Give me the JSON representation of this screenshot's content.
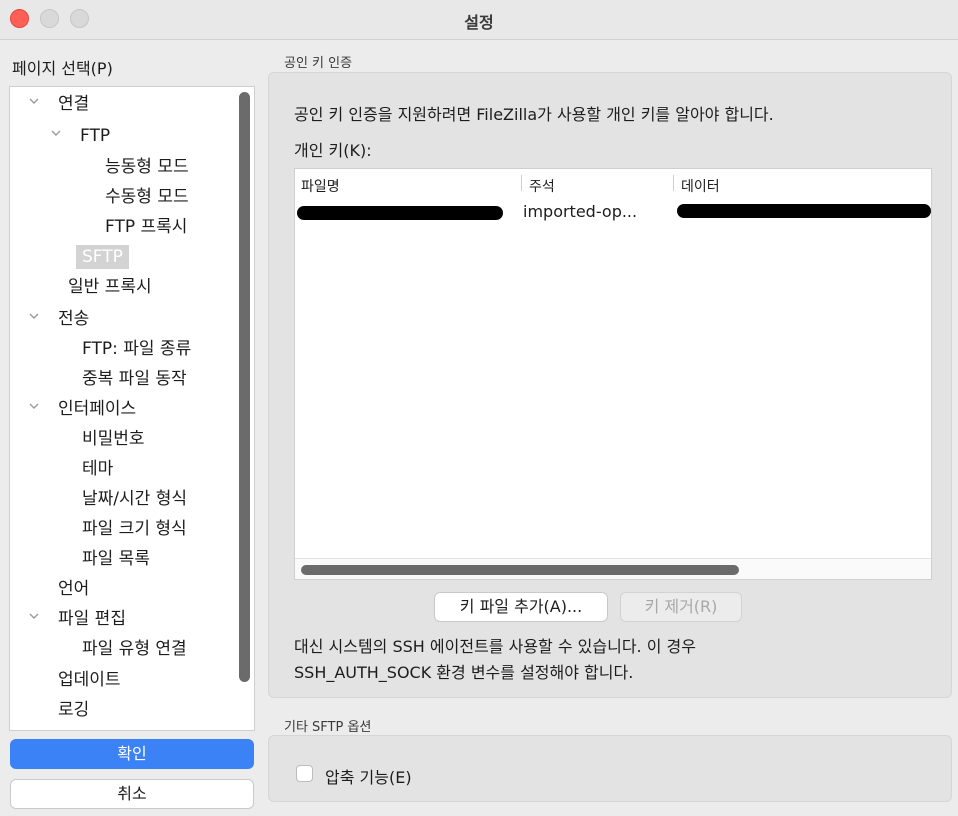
{
  "window": {
    "title": "설정"
  },
  "sidebar": {
    "heading": "페이지 선택(P)",
    "items": [
      {
        "label": "연결"
      },
      {
        "label": "FTP"
      },
      {
        "label": "능동형 모드"
      },
      {
        "label": "수동형 모드"
      },
      {
        "label": "FTP 프록시"
      },
      {
        "label": "SFTP"
      },
      {
        "label": "일반 프록시"
      },
      {
        "label": "전송"
      },
      {
        "label": "FTP: 파일 종류"
      },
      {
        "label": "중복 파일 동작"
      },
      {
        "label": "인터페이스"
      },
      {
        "label": "비밀번호"
      },
      {
        "label": "테마"
      },
      {
        "label": "날짜/시간 형식"
      },
      {
        "label": "파일 크기 형식"
      },
      {
        "label": "파일 목록"
      },
      {
        "label": "언어"
      },
      {
        "label": "파일 편집"
      },
      {
        "label": "파일 유형 연결"
      },
      {
        "label": "업데이트"
      },
      {
        "label": "로깅"
      }
    ],
    "selected": "SFTP",
    "ok_label": "확인",
    "cancel_label": "취소"
  },
  "pubkey": {
    "group_title": "공인 키 인증",
    "description": "공인 키 인증을 지원하려면 FileZilla가 사용할 개인 키를 알아야 합니다.",
    "keys_label": "개인 키(K):",
    "columns": [
      "파일명",
      "주석",
      "데이터"
    ],
    "rows": [
      {
        "comment": "imported-op..."
      }
    ],
    "add_button": "키 파일 추가(A)...",
    "remove_button": "키 제거(R)",
    "agent_note_line1": "대신 시스템의 SSH 에이전트를 사용할 수 있습니다. 이 경우",
    "agent_note_line2": "SSH_AUTH_SOCK 환경 변수를 설정해야 합니다."
  },
  "other_options": {
    "group_title": "기타 SFTP 옵션",
    "compression_label": "압축 기능(E)",
    "compression_checked": false
  },
  "colors": {
    "accent": "#3b82f6",
    "close_button": "#ff5f57",
    "redaction": "#000000"
  }
}
